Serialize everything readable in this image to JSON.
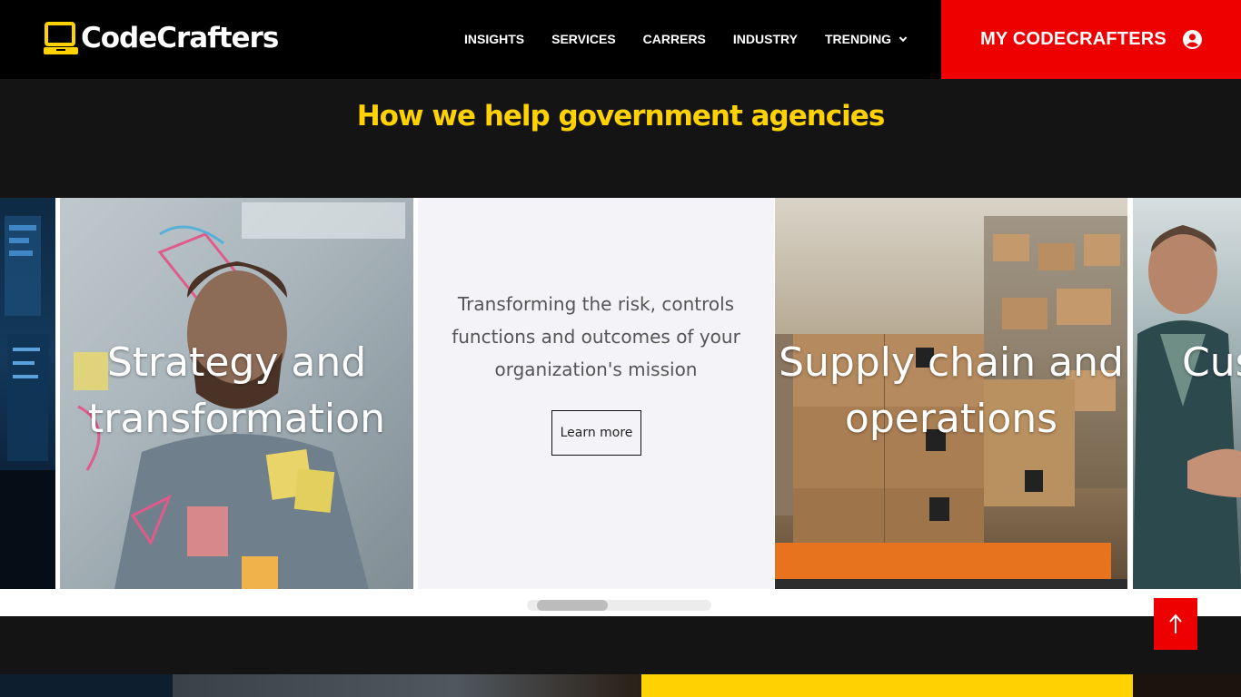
{
  "header": {
    "logo_text": "CodeCrafters",
    "logo_icon": "laptop-icon",
    "nav": [
      {
        "label": "INSIGHTS"
      },
      {
        "label": "SERVICES"
      },
      {
        "label": "CARRERS"
      },
      {
        "label": "INDUSTRY"
      },
      {
        "label": "TRENDING",
        "has_dropdown": true
      }
    ],
    "account_label": "MY CODECRAFTERS",
    "account_icon": "user-circle-icon"
  },
  "section": {
    "heading": "How we help government agencies"
  },
  "carousel": {
    "cards": [
      {
        "title": "",
        "image": "tech-dashboard-photo"
      },
      {
        "title": "Strategy and transformation",
        "title_lines": [
          "Strategy and",
          "transformation"
        ],
        "image": "man-thinking-sticky-notes-photo"
      },
      {
        "description_lines": [
          "Transforming the risk, controls",
          "functions and outcomes of your",
          "organization's mission"
        ],
        "button": "Learn more"
      },
      {
        "title": "Supply chain and operations",
        "title_lines": [
          "Supply chain and",
          "operations"
        ],
        "image": "warehouse-boxes-photo"
      },
      {
        "title": "Cus",
        "image": "handshake-photo"
      }
    ],
    "scroll_position": 0.09
  },
  "back_to_top_icon": "arrow-up-icon",
  "colors": {
    "accent_red": "#ee0000",
    "heading_yellow": "#ffd200",
    "background": "#141414",
    "nav_bg": "#000000"
  }
}
